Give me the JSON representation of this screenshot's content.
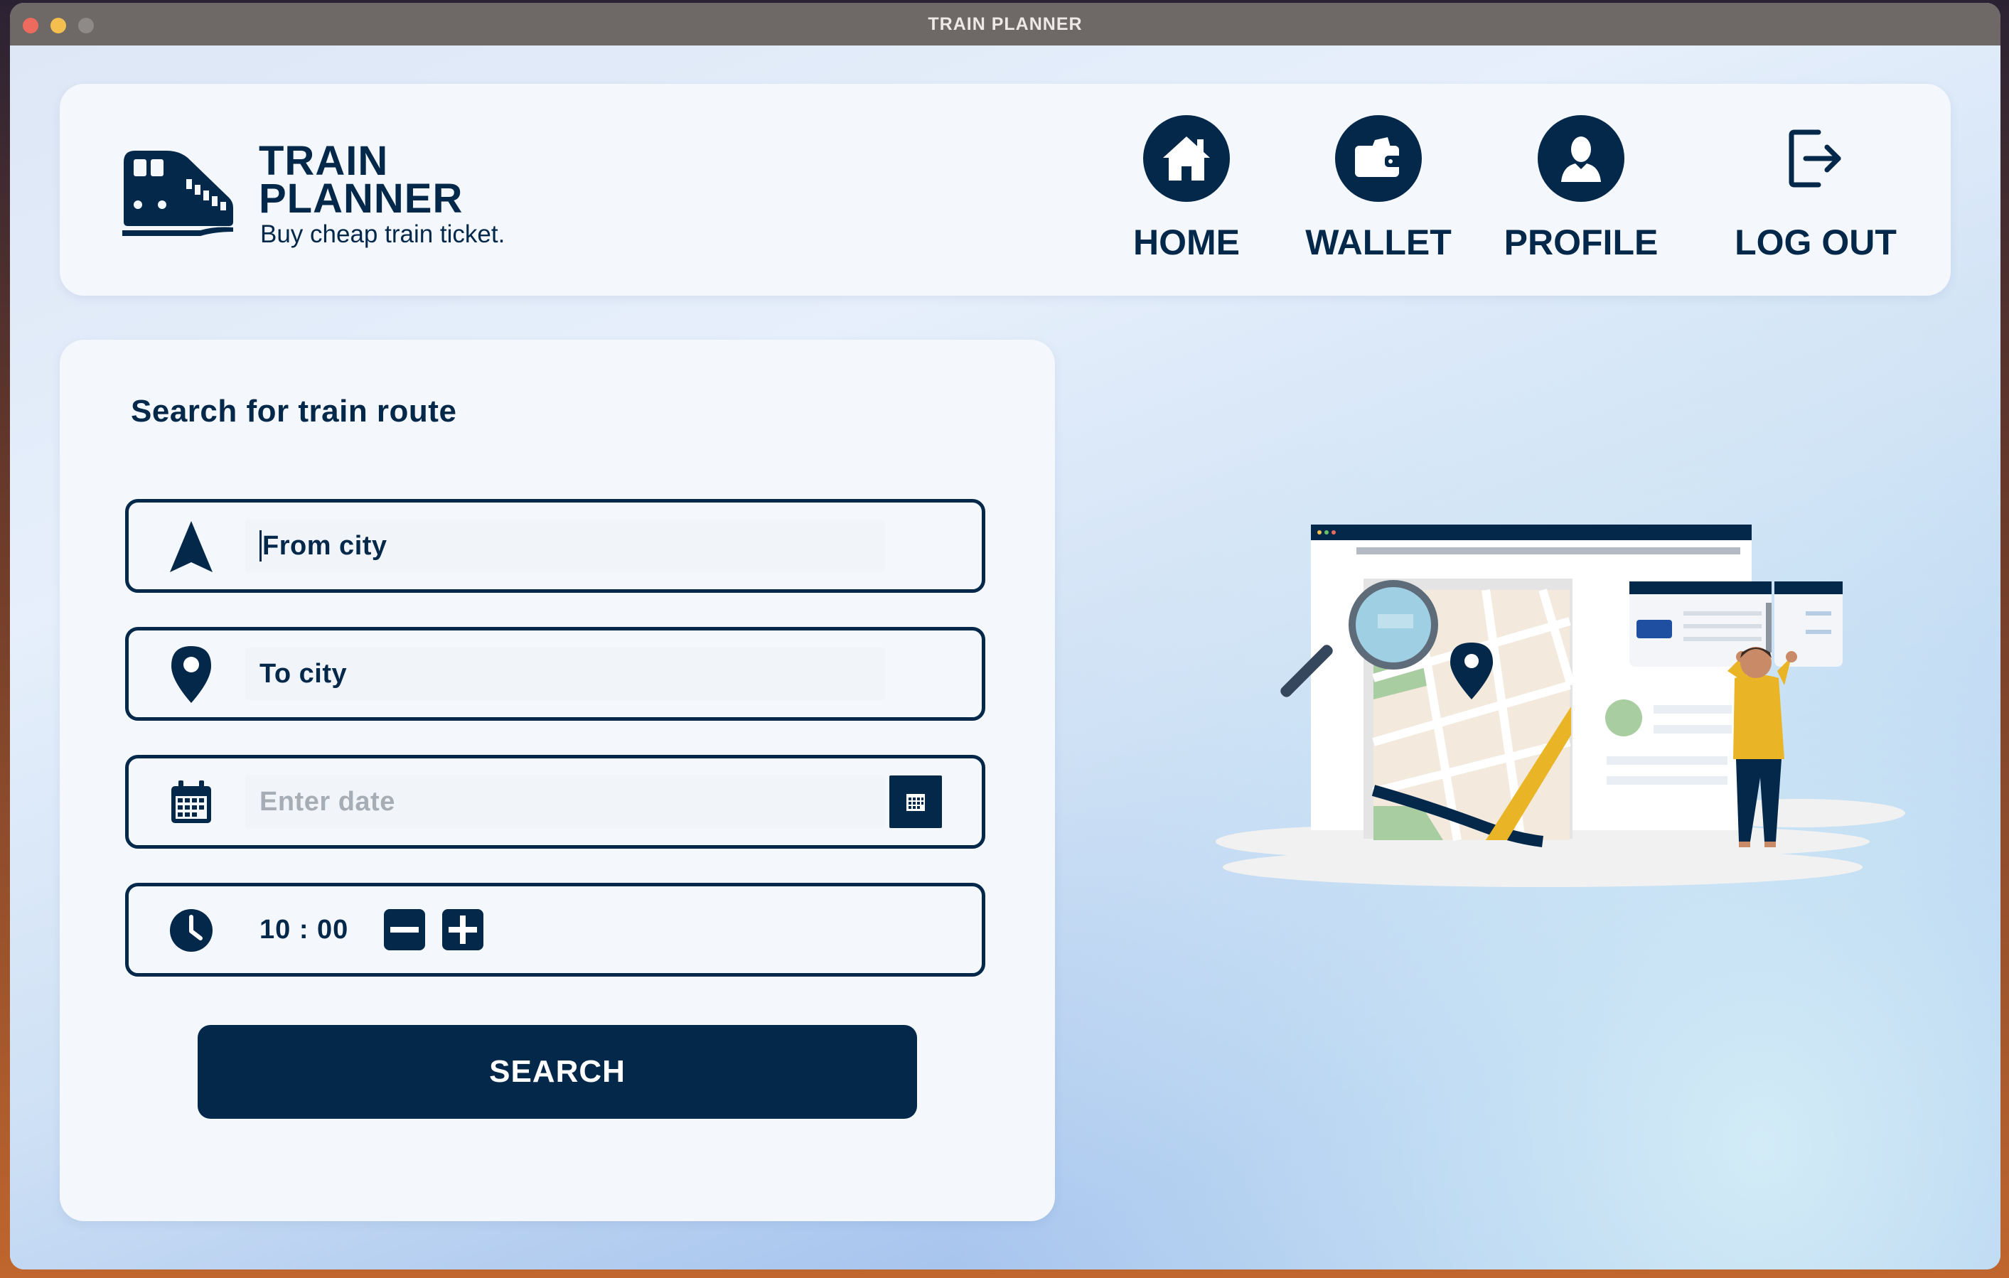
{
  "window": {
    "title": "TRAIN PLANNER"
  },
  "brand": {
    "title_line1": "TRAIN",
    "title_line2": "PLANNER",
    "tagline": "Buy cheap train ticket."
  },
  "nav": {
    "home": "HOME",
    "wallet": "WALLET",
    "profile": "PROFILE",
    "logout": "LOG OUT"
  },
  "search_form": {
    "title": "Search for train route",
    "from_city": {
      "value": "From city",
      "icon": "navigation-arrow-icon"
    },
    "to_city": {
      "value": "To city",
      "icon": "map-pin-icon"
    },
    "date": {
      "placeholder": "Enter date",
      "icon": "calendar-icon"
    },
    "time": {
      "value": "10 : 00",
      "icon": "clock-icon"
    },
    "search_button": "SEARCH"
  },
  "colors": {
    "primary": "#04284a",
    "panel": "#f4f7fb",
    "placeholder": "#a7adb4",
    "accent_yellow": "#e9b526"
  }
}
